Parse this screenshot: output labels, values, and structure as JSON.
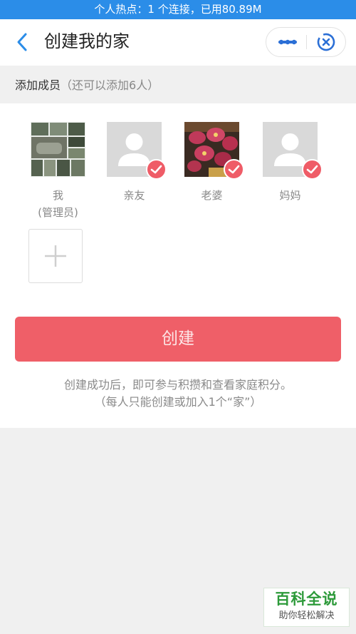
{
  "status_bar": {
    "hotspot_text": "个人热点：1 个连接，已用80.89M"
  },
  "nav": {
    "title": "创建我的家",
    "back_icon": "chevron-left-icon",
    "more_icon": "ellipsis-icon",
    "close_icon": "target-close-icon"
  },
  "members_section": {
    "label": "添加成员",
    "hint": "（还可以添加6人）"
  },
  "members": [
    {
      "name": "我",
      "role": "(管理员)",
      "avatar": "photo-collage",
      "selected": false
    },
    {
      "name": "亲友",
      "role": "",
      "avatar": "placeholder-person",
      "selected": true
    },
    {
      "name": "老婆",
      "role": "",
      "avatar": "photo-flowers",
      "selected": true
    },
    {
      "name": "妈妈",
      "role": "",
      "avatar": "placeholder-person",
      "selected": true
    }
  ],
  "add_member_icon": "plus-icon",
  "create_button": {
    "label": "创建"
  },
  "notes": {
    "line1": "创建成功后，即可参与积攒和查看家庭积分。",
    "line2": "（每人只能创建或加入1个“家”）"
  },
  "watermark": {
    "title": "百科全说",
    "subtitle": "助你轻松解决"
  },
  "colors": {
    "status_bar": "#2b8de8",
    "accent_red": "#ef5f68",
    "nav_icon_blue": "#2b8de8"
  }
}
